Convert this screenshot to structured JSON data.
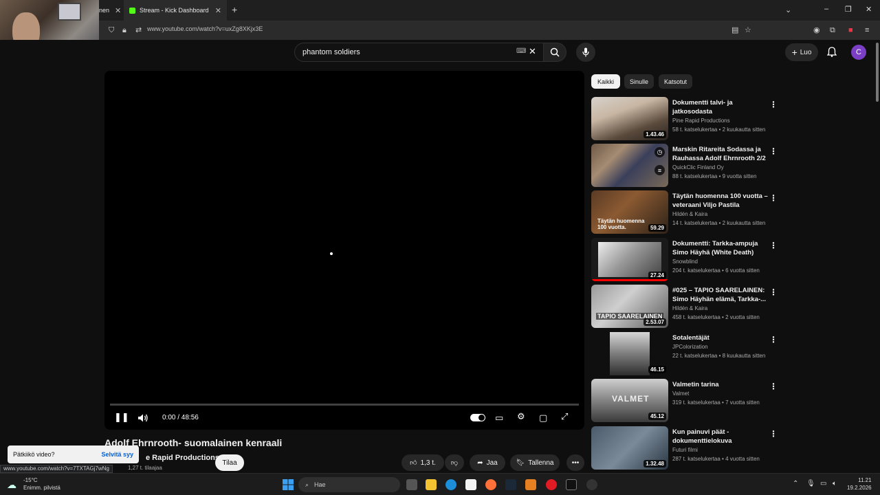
{
  "browser": {
    "tabs": [
      {
        "label": "nen",
        "active": false
      },
      {
        "label": "Stream - Kick Dashboard",
        "active": false
      }
    ],
    "new_tab": "+",
    "url": "www.youtube.com/watch?v=uxZg8XKjx3E",
    "status_url": "www.youtube.com/watch?v=7TXTAGj7wNg"
  },
  "header": {
    "search_query": "phantom soldiers",
    "create_label": "Luo",
    "avatar_letter": "C"
  },
  "player": {
    "time": "0:00 / 48:56",
    "progress": 0
  },
  "video": {
    "title": "Adolf Ehrnrooth- suomalainen kenraali",
    "channel": "e Rapid Productions",
    "subscribers": "1,27 t. tilaajaa",
    "subscribe_label": "Tilaa",
    "like_count": "1,3 t.",
    "share_label": "Jaa",
    "save_label": "Tallenna"
  },
  "popup": {
    "question": "Pätkiikö video?",
    "action": "Selvitä syy"
  },
  "chips": [
    {
      "label": "Kaikki",
      "active": true
    },
    {
      "label": "Sinulle",
      "active": false
    },
    {
      "label": "Katsotut",
      "active": false
    }
  ],
  "recommendations": [
    {
      "title": "Dokumentti talvi- ja jatkosodasta",
      "channel": "Pine Rapid Productions",
      "meta": "58 t. katselukertaa • 2 kuukautta sitten",
      "duration": "1.43.46",
      "watched": 0
    },
    {
      "title": "Marskin Ritareita Sodassa ja Rauhassa Adolf Ehrnrooth 2/2",
      "channel": "QuickClic Finland Oy",
      "meta": "88 t. katselukertaa • 9 vuotta sitten",
      "duration": "",
      "watched": 0
    },
    {
      "title": "Täytän huomenna 100 vuotta – veteraani Viljo Pastila",
      "channel": "Hildén & Kaira",
      "meta": "14 t. katselukertaa • 2 kuukautta sitten",
      "duration": "59.29",
      "overlay": "Täytän huomenna 100 vuotta.",
      "watched": 0
    },
    {
      "title": "Dokumentti: Tarkka-ampuja Simo Häyhä (White Death)",
      "channel": "Snowblind",
      "meta": "204 t. katselukertaa • 6 vuotta sitten",
      "duration": "27.24",
      "watched": 1
    },
    {
      "title": "#025 – TAPIO SAARELAINEN: Simo Häyhän elämä, Tarkka-...",
      "channel": "Hildén & Kaira",
      "meta": "458 t. katselukertaa • 2 vuotta sitten",
      "duration": "2.53.07",
      "overlay": "TAPIO SAARELAINEN",
      "watched": 0
    },
    {
      "title": "Sotalentäjät",
      "channel": "JPColorization",
      "meta": "22 t. katselukertaa • 8 kuukautta sitten",
      "duration": "46.15",
      "watched": 0
    },
    {
      "title": "Valmetin tarina",
      "channel": "Valmet",
      "meta": "319 t. katselukertaa • 7 vuotta sitten",
      "duration": "45.12",
      "overlay": "VALMET",
      "watched": 0
    },
    {
      "title": "Kun painuvi päät - dokumenttielokuva",
      "channel": "Futuri filmi",
      "meta": "287 t. katselukertaa • 4 vuotta sitten",
      "duration": "1.32.48",
      "watched": 0
    }
  ],
  "taskbar": {
    "weather_temp": "-15°C",
    "weather_desc": "Enimm. pilvistä",
    "search_label": "Hae",
    "time": "11.21",
    "date": "19.2.2026"
  },
  "colors": {
    "accent": "#ff0000",
    "avatar": "#7a3fc4",
    "link": "#065fd4"
  }
}
